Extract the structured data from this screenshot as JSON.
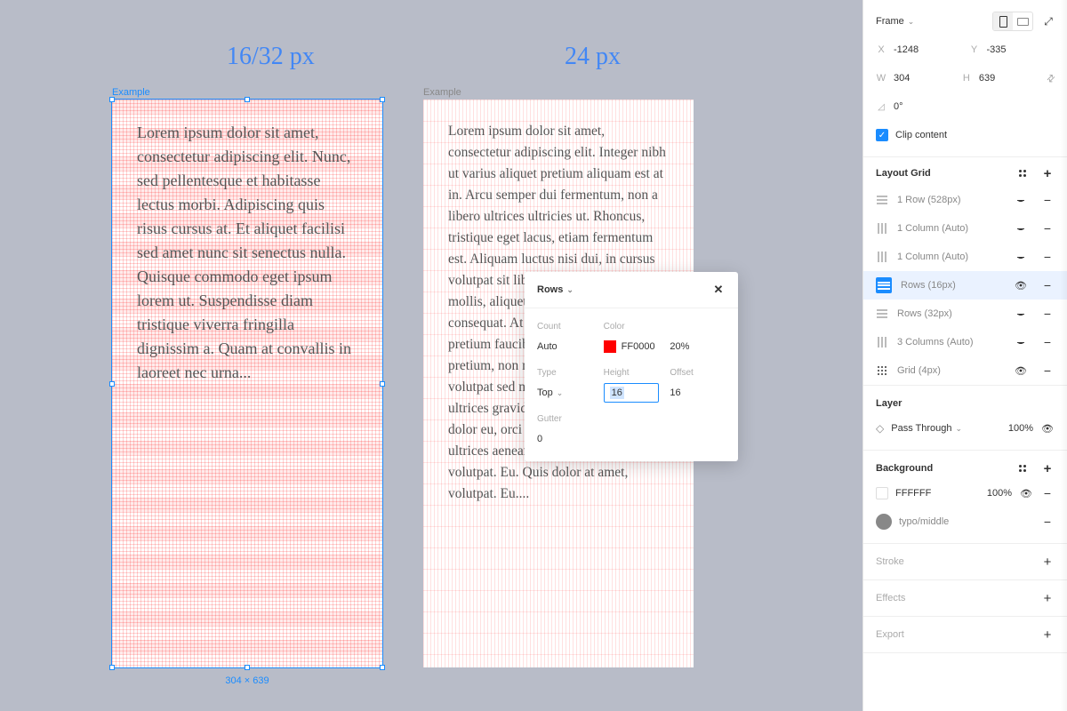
{
  "canvas": {
    "heading1": "16/32 px",
    "heading2": "24 px",
    "frame_label": "Example",
    "text1": "Lorem ipsum dolor sit amet, consectetur adipiscing elit. Nunc, sed pellentesque et habitasse lectus morbi. Adipiscing quis risus cursus at. Et aliquet facilisi sed amet nunc sit senectus nulla. Quisque commodo eget ipsum lorem ut. Suspendisse diam tristique viverra fringilla dignissim a. Quam at convallis in laoreet nec urna...",
    "text2": "Lorem ipsum dolor sit amet, consectetur adipiscing elit. Integer nibh ut varius aliquet pretium aliquam est at in. Arcu semper dui fermentum, non a libero ultrices ultricies ut. Rhoncus, tristique eget lacus, etiam fermentum est. Aliquam luctus nisi dui, in cursus volutpat sit libero. Pulvinar vitae, mollis, aliquet et, nunc, diam dignissim consequat. At id bibendum vitae pretium faucibus sed ultricies vel, pretium, non massa risus, purus amet, volutpat sed nam. Dolor euismod ultrices gravida lacinia urna. Ipsum dolor eu, orci in fermentum euismod ultrices aenean. Quis dolor at amet, volutpat. Eu. Quis dolor at amet, volutpat. Eu....",
    "dims": "304 × 639"
  },
  "inspector": {
    "type_label": "Frame",
    "x_label": "X",
    "x": "-1248",
    "y_label": "Y",
    "y": "-335",
    "w_label": "W",
    "w": "304",
    "h_label": "H",
    "h": "639",
    "rotation": "0°",
    "clip_label": "Clip content",
    "layout_grid": {
      "title": "Layout Grid",
      "items": [
        {
          "name": "1 Row (528px)",
          "icon": "rows",
          "vis": "hidden"
        },
        {
          "name": "1 Column (Auto)",
          "icon": "cols",
          "vis": "hidden"
        },
        {
          "name": "1 Column (Auto)",
          "icon": "cols",
          "vis": "hidden"
        },
        {
          "name": "Rows (16px)",
          "icon": "rows-active",
          "vis": "shown",
          "active": true
        },
        {
          "name": "Rows (32px)",
          "icon": "rows",
          "vis": "hidden"
        },
        {
          "name": "3 Columns (Auto)",
          "icon": "cols",
          "vis": "hidden"
        },
        {
          "name": "Grid (4px)",
          "icon": "grid",
          "vis": "shown"
        }
      ]
    },
    "layer": {
      "title": "Layer",
      "blend": "Pass Through",
      "opacity": "100%"
    },
    "background": {
      "title": "Background",
      "hex": "FFFFFF",
      "opacity": "100%"
    },
    "style": {
      "name": "typo/middle"
    },
    "stroke": "Stroke",
    "effects": "Effects",
    "export": "Export"
  },
  "popover": {
    "title": "Rows",
    "count_label": "Count",
    "count": "Auto",
    "color_label": "Color",
    "color": "FF0000",
    "opacity": "20%",
    "type_label": "Type",
    "type": "Top",
    "height_label": "Height",
    "height": "16",
    "offset_label": "Offset",
    "offset": "16",
    "gutter_label": "Gutter",
    "gutter": "0"
  }
}
